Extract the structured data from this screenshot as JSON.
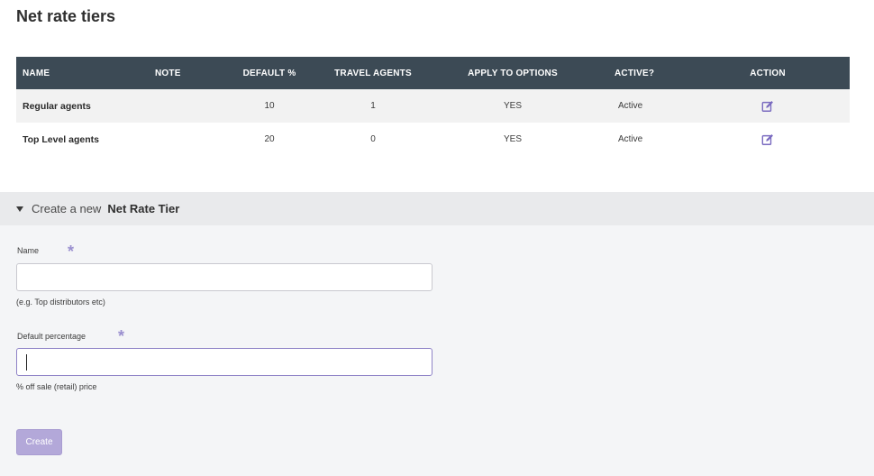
{
  "page": {
    "title": "Net rate tiers"
  },
  "table": {
    "headers": {
      "name": "NAME",
      "note": "NOTE",
      "default_pct": "DEFAULT %",
      "travel_agents": "TRAVEL AGENTS",
      "apply_to_options": "APPLY TO OPTIONS",
      "active": "ACTIVE?",
      "action": "ACTION"
    },
    "rows": [
      {
        "name": "Regular agents",
        "note": "",
        "default_pct": "10",
        "travel_agents": "1",
        "apply_to_options": "YES",
        "active": "Active",
        "action_icon": "edit-icon"
      },
      {
        "name": "Top Level agents",
        "note": "",
        "default_pct": "20",
        "travel_agents": "0",
        "apply_to_options": "YES",
        "active": "Active",
        "action_icon": "edit-icon"
      }
    ]
  },
  "create": {
    "prefix": "Create a new",
    "strong": "Net Rate Tier",
    "fields": {
      "name": {
        "label": "Name",
        "value": "",
        "placeholder": "",
        "help": "(e.g. Top distributors etc)"
      },
      "default_percentage": {
        "label": "Default percentage",
        "value": "",
        "placeholder": "",
        "help": "% off sale (retail) price"
      }
    },
    "required_marker": "*",
    "button_label": "Create"
  },
  "colors": {
    "table_header_bg": "#3c4a55",
    "accent": "#8f83c7",
    "button_bg": "#b3a8d9",
    "section_bg": "#f4f5f7"
  }
}
